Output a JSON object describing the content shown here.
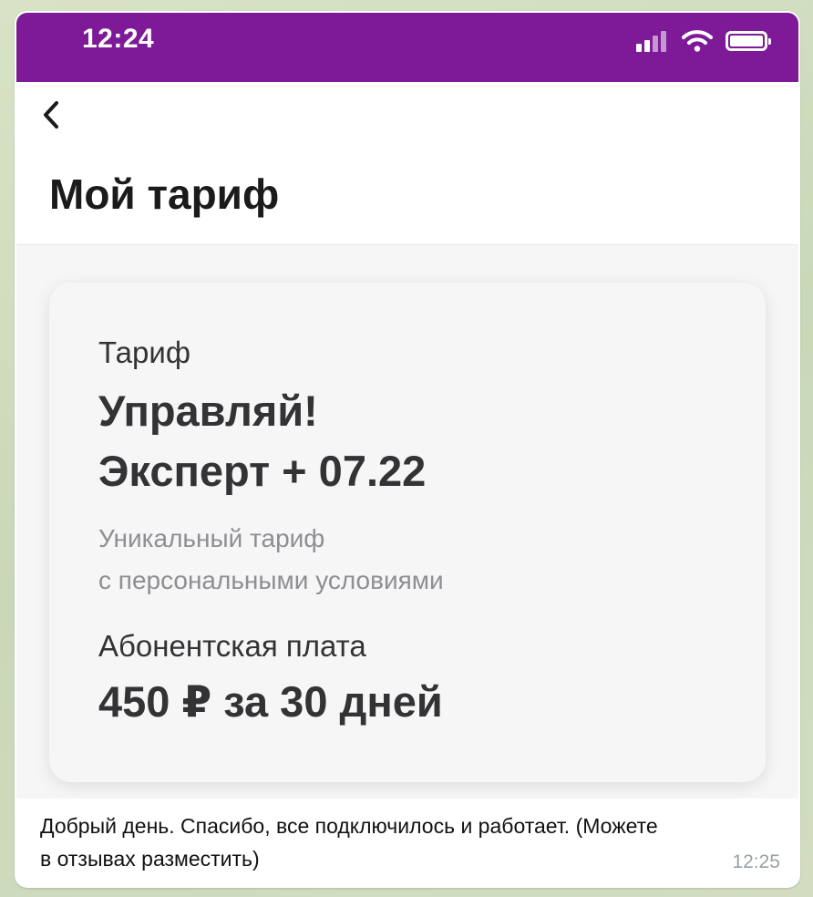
{
  "status_bar": {
    "time": "12:24",
    "icons": [
      "signal-icon",
      "wifi-icon",
      "battery-icon"
    ],
    "color": "#7e1a97"
  },
  "header": {
    "back_icon": "chevron-left-icon",
    "title": "Мой тариф"
  },
  "tariff": {
    "label": "Тариф",
    "name_line1": "Управляй!",
    "name_line2": "Эксперт + 07.22",
    "description_line1": "Уникальный тариф",
    "description_line2": "с персональными условиями",
    "fee_label": "Абонентская плата",
    "fee_value": "450 ₽ за 30 дней"
  },
  "message": {
    "text_line1": "Добрый день. Спасибо, все подключилось и работает. (Можете",
    "text_line2": "в отзывах разместить)",
    "time": "12:25"
  }
}
